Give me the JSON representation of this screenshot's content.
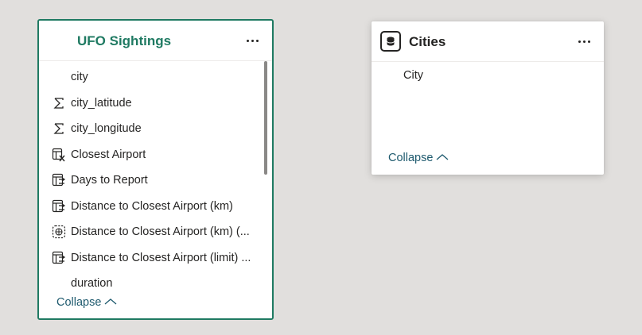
{
  "ufo_card": {
    "title": "UFO Sightings",
    "more_icon": "more-options-icon",
    "fields": [
      {
        "label": "city",
        "icon": "none"
      },
      {
        "label": "city_latitude",
        "icon": "sigma-icon"
      },
      {
        "label": "city_longitude",
        "icon": "sigma-icon"
      },
      {
        "label": "Closest Airport",
        "icon": "calculated-column-icon"
      },
      {
        "label": "Days to Report",
        "icon": "measure-table-icon"
      },
      {
        "label": "Distance to Closest Airport (km)",
        "icon": "measure-table-icon"
      },
      {
        "label": "Distance to Closest Airport (km) (...",
        "icon": "geo-dashed-icon"
      },
      {
        "label": "Distance to Closest Airport (limit) ...",
        "icon": "measure-table-icon"
      },
      {
        "label": "duration",
        "icon": "none"
      }
    ],
    "collapse_label": "Collapse"
  },
  "cities_card": {
    "title": "Cities",
    "table_icon": "database-icon",
    "fields": [
      {
        "label": "City"
      }
    ],
    "collapse_label": "Collapse"
  },
  "colors": {
    "accent": "#1f7a62",
    "link": "#1e5a6e",
    "canvas": "#e1dfdd"
  }
}
